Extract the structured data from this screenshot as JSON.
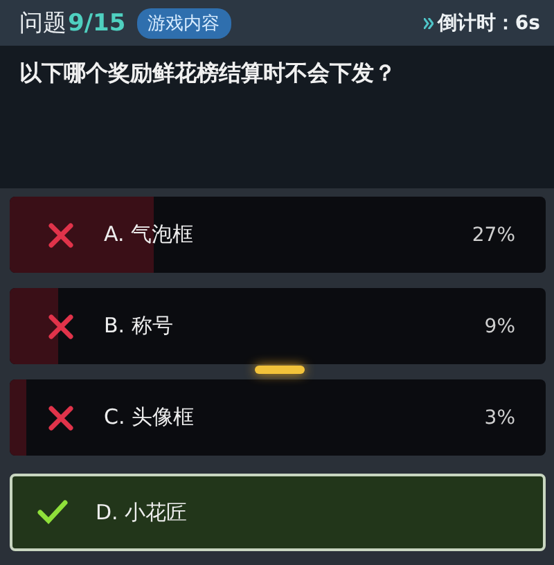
{
  "header": {
    "label": "问题",
    "progress": "9/15",
    "tag": "游戏内容",
    "timer": "倒计时：6s"
  },
  "question": "以下哪个奖励鲜花榜结算时不会下发？",
  "options": [
    {
      "text": "A. 气泡框",
      "percent": "27%",
      "level": 0.27,
      "correct": false
    },
    {
      "text": "B. 称号",
      "percent": "9%",
      "level": 0.09,
      "correct": false
    },
    {
      "text": "C. 头像框",
      "percent": "3%",
      "level": 0.03,
      "correct": false
    },
    {
      "text": "D. 小花匠",
      "correct": true
    }
  ]
}
